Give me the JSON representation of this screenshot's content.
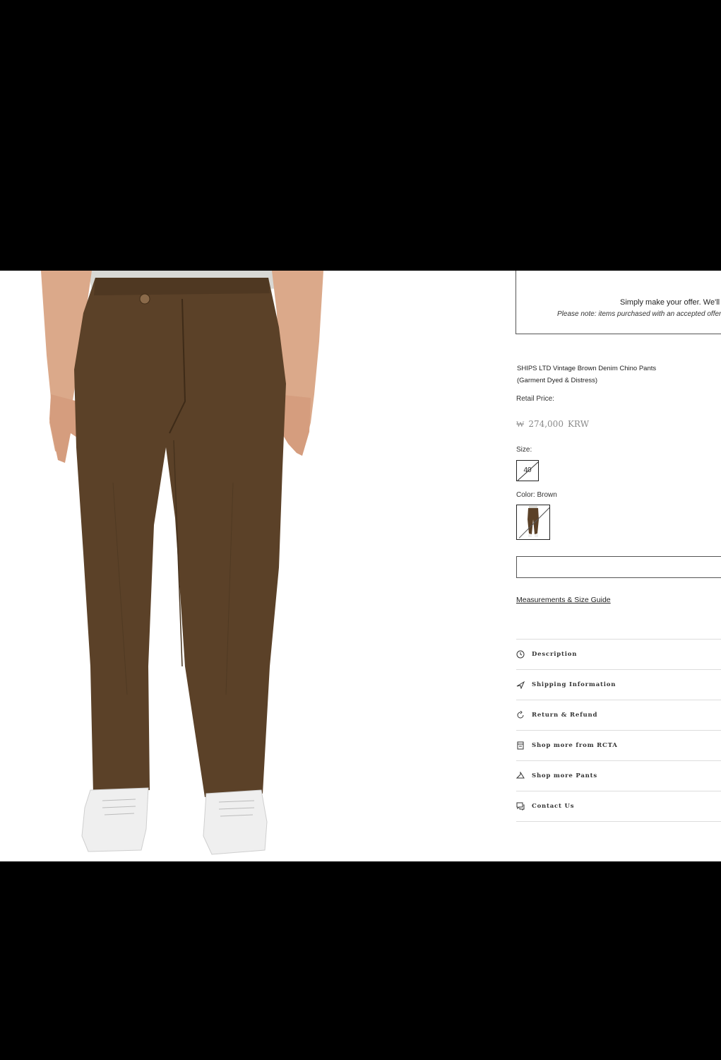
{
  "offer": {
    "line1": "Simply make your offer. We'll l",
    "line2": "Please note: items purchased with an accepted offer"
  },
  "product": {
    "title_line1": "SHIPS LTD Vintage Brown Denim Chino Pants",
    "title_line2": "(Garment Dyed & Distress)",
    "retail_label": "Retail Price:",
    "price_symbol": "₩",
    "price_value": "274,000",
    "price_currency": "KRW",
    "size_label": "Size:",
    "size_value": "40",
    "color_label": "Color: Brown",
    "size_guide_link": "Measurements & Size Guide"
  },
  "info_items": [
    {
      "label": "Description",
      "icon": "clock-icon"
    },
    {
      "label": "Shipping Information",
      "icon": "plane-icon"
    },
    {
      "label": "Return & Refund",
      "icon": "refresh-icon"
    },
    {
      "label": "Shop more from RCTA",
      "icon": "store-icon"
    },
    {
      "label": "Shop more Pants",
      "icon": "hanger-icon"
    },
    {
      "label": "Contact Us",
      "icon": "chat-icon"
    }
  ],
  "colors": {
    "pants": "#5b4128",
    "shirt": "#d8d8d4",
    "skin": "#d9a888",
    "shoes": "#efefef"
  }
}
